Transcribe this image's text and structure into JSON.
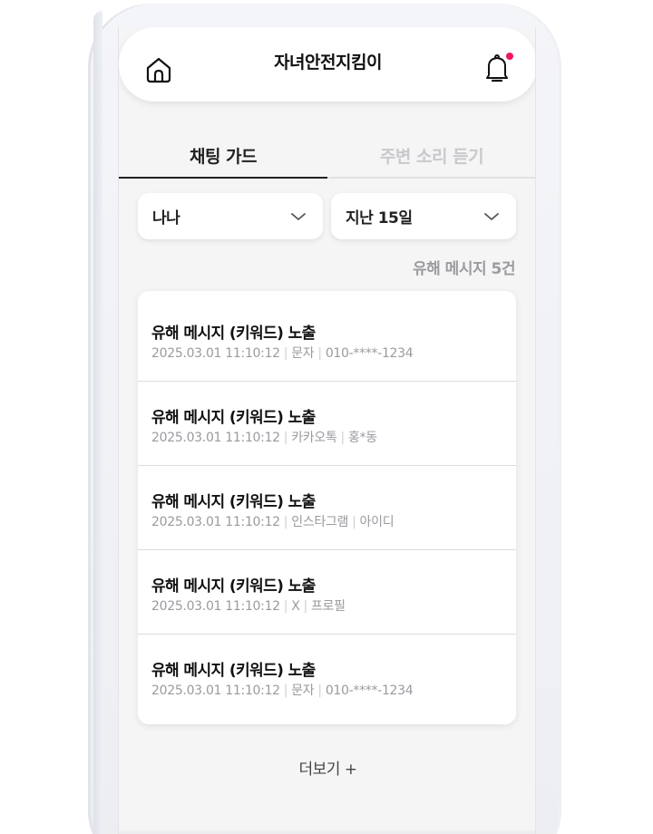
{
  "app": {
    "title": "자녀안전지킴이"
  },
  "tabs": [
    {
      "label": "채팅 가드",
      "active": true
    },
    {
      "label": "주변 소리 듣기",
      "active": false
    }
  ],
  "filters": {
    "member": {
      "value": "나나"
    },
    "period": {
      "value": "지난 15일"
    }
  },
  "summary": {
    "count_label": "유해 메시지 5건"
  },
  "messages": [
    {
      "title": "유해 메시지 (키워드) 노출",
      "datetime": "2025.03.01 11:10:12",
      "source": "문자",
      "target": "010-****-1234"
    },
    {
      "title": "유해 메시지 (키워드) 노출",
      "datetime": "2025.03.01 11:10:12",
      "source": "카카오톡",
      "target": "홍*동"
    },
    {
      "title": "유해 메시지 (키워드) 노출",
      "datetime": "2025.03.01 11:10:12",
      "source": "인스타그램",
      "target": "아이디"
    },
    {
      "title": "유해 메시지 (키워드) 노출",
      "datetime": "2025.03.01 11:10:12",
      "source": "X",
      "target": "프로필"
    },
    {
      "title": "유해 메시지 (키워드) 노출",
      "datetime": "2025.03.01 11:10:12",
      "source": "문자",
      "target": "010-****-1234"
    }
  ],
  "more": {
    "label": "더보기 +"
  },
  "colors": {
    "accent_dot": "#f0185a",
    "text_primary": "#111111",
    "text_muted": "#9a9aa0",
    "tab_inactive": "#c9c9cd"
  }
}
